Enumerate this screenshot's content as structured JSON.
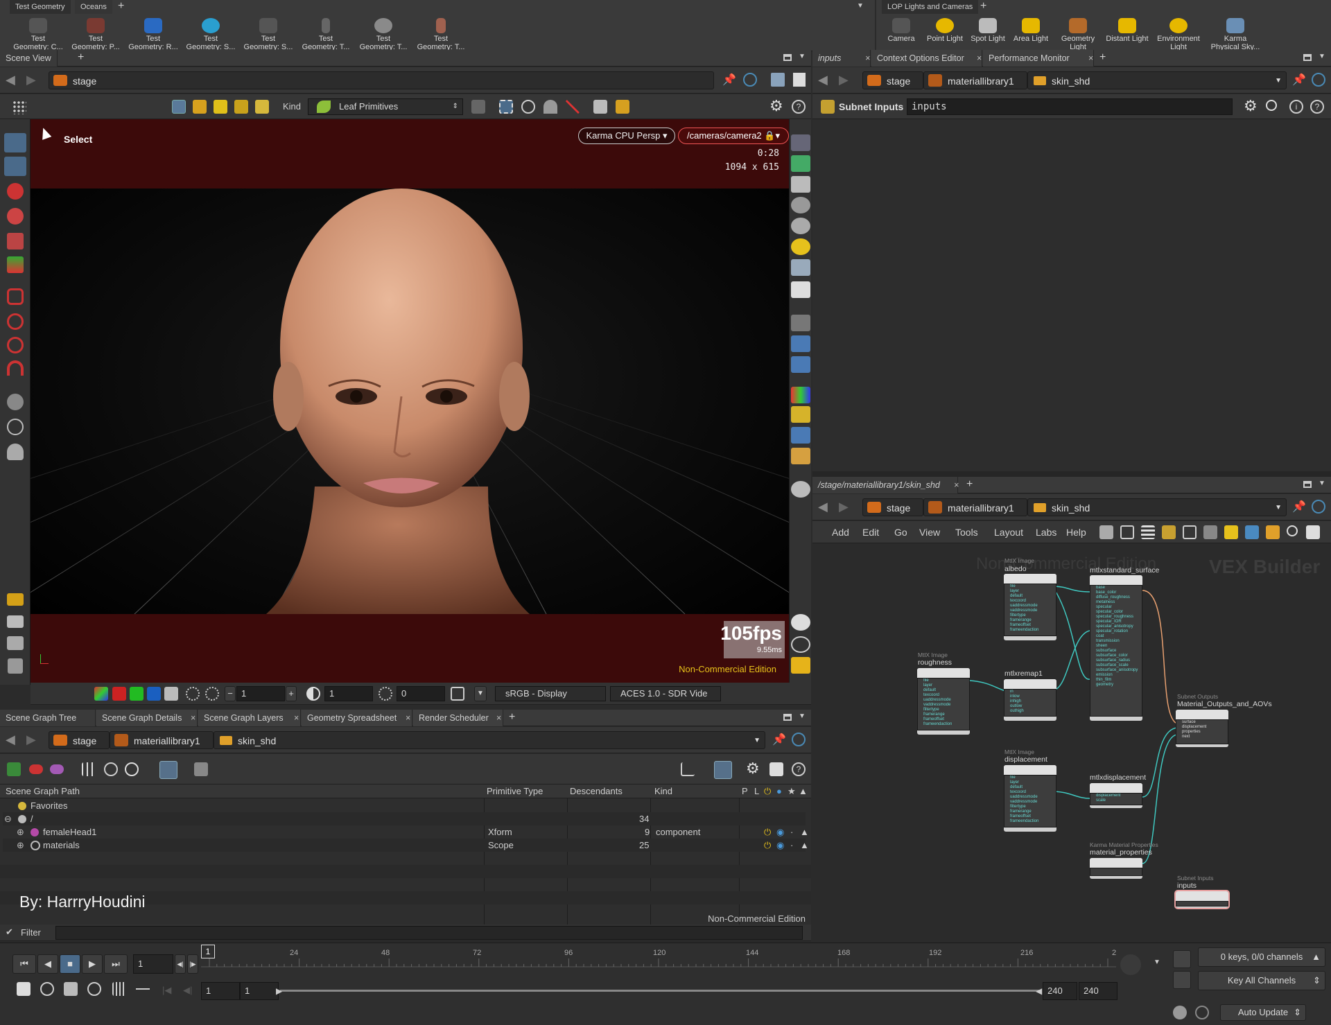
{
  "top_shelf": {
    "tabs": [
      "Test Geometry",
      "Oceans"
    ],
    "tools": [
      {
        "line1": "Test",
        "line2": "Geometry: C..."
      },
      {
        "line1": "Test",
        "line2": "Geometry: P..."
      },
      {
        "line1": "Test",
        "line2": "Geometry: R..."
      },
      {
        "line1": "Test",
        "line2": "Geometry: S..."
      },
      {
        "line1": "Test",
        "line2": "Geometry: S..."
      },
      {
        "line1": "Test",
        "line2": "Geometry: T..."
      },
      {
        "line1": "Test",
        "line2": "Geometry: T..."
      },
      {
        "line1": "Test",
        "line2": "Geometry: T..."
      }
    ]
  },
  "lights_shelf": {
    "tab": "LOP Lights and Cameras",
    "tools": [
      {
        "line1": "Camera",
        "line2": ""
      },
      {
        "line1": "Point Light",
        "line2": ""
      },
      {
        "line1": "Spot Light",
        "line2": ""
      },
      {
        "line1": "Area Light",
        "line2": ""
      },
      {
        "line1": "Geometry",
        "line2": "Light"
      },
      {
        "line1": "Distant Light",
        "line2": ""
      },
      {
        "line1": "Environment",
        "line2": "Light"
      },
      {
        "line1": "Karma",
        "line2": "Physical Sky..."
      }
    ]
  },
  "scene_view": {
    "tab": "Scene View",
    "path": "stage",
    "kind_label": "Kind",
    "kind_value": "Leaf Primitives",
    "select_label": "Select",
    "renderer": "Karma CPU  Persp",
    "camera": "/cameras/camera2",
    "time": "0:28",
    "resolution": "1094 x 615",
    "fps": "105fps",
    "ms": "9.55ms",
    "watermark": "Non-Commercial Edition",
    "bottom": {
      "field1": "1",
      "field2": "1",
      "field3": "0",
      "display": "sRGB - Display",
      "view": "ACES 1.0 - SDR Vide"
    }
  },
  "top_right_pane": {
    "tabs": [
      "inputs",
      "Context Options Editor",
      "Performance Monitor"
    ],
    "path": [
      "stage",
      "materiallibrary1",
      "skin_shd"
    ],
    "subnet_label": "Subnet Inputs",
    "subnet_value": "inputs"
  },
  "scene_graph": {
    "tabs": [
      "Scene Graph Tree",
      "Scene Graph Details",
      "Scene Graph Layers",
      "Geometry Spreadsheet",
      "Render Scheduler"
    ],
    "path": [
      "stage",
      "materiallibrary1",
      "skin_shd"
    ],
    "columns": [
      "Scene Graph Path",
      "Primitive Type",
      "Descendants",
      "Kind",
      "P",
      "L"
    ],
    "rows": [
      {
        "name": "Favorites",
        "type": "",
        "desc": "",
        "kind": ""
      },
      {
        "name": "/",
        "type": "",
        "desc": "34",
        "kind": ""
      },
      {
        "name": "femaleHead1",
        "type": "Xform",
        "desc": "9",
        "kind": "component"
      },
      {
        "name": "materials",
        "type": "Scope",
        "desc": "25",
        "kind": ""
      }
    ],
    "credit": "By: HarrryHoudini",
    "watermark": "Non-Commercial Edition",
    "filter_label": "Filter"
  },
  "network": {
    "tab": "/stage/materiallibrary1/skin_shd",
    "path": [
      "stage",
      "materiallibrary1",
      "skin_shd"
    ],
    "menu": [
      "Add",
      "Edit",
      "Go",
      "View",
      "Tools",
      "Layout",
      "Labs",
      "Help"
    ],
    "watermark": "Non-Commercial Edition",
    "context": "VEX Builder",
    "nodes": [
      {
        "type": "MtlX Image",
        "name": "albedo"
      },
      {
        "type": "",
        "name": "mtlxstandard_surface"
      },
      {
        "type": "MtlX Image",
        "name": "roughness"
      },
      {
        "type": "",
        "name": "mtlxremap1"
      },
      {
        "type": "Subnet Outputs",
        "name": "Material_Outputs_and_AOVs"
      },
      {
        "type": "MtlX Image",
        "name": "displacement"
      },
      {
        "type": "",
        "name": "mtlxdisplacement"
      },
      {
        "type": "Karma Material Properties",
        "name": "material_properties"
      },
      {
        "type": "Subnet Inputs",
        "name": "inputs"
      }
    ]
  },
  "timeline": {
    "ticks": [
      "24",
      "48",
      "72",
      "96",
      "120",
      "144",
      "168",
      "192",
      "216",
      "2"
    ],
    "marker": "1",
    "frame": "1",
    "start": "1",
    "start2": "1",
    "end": "240",
    "end2": "240",
    "keys": "0 keys, 0/0 channels",
    "key_all": "Key All Channels",
    "auto_update": "Auto Update"
  }
}
